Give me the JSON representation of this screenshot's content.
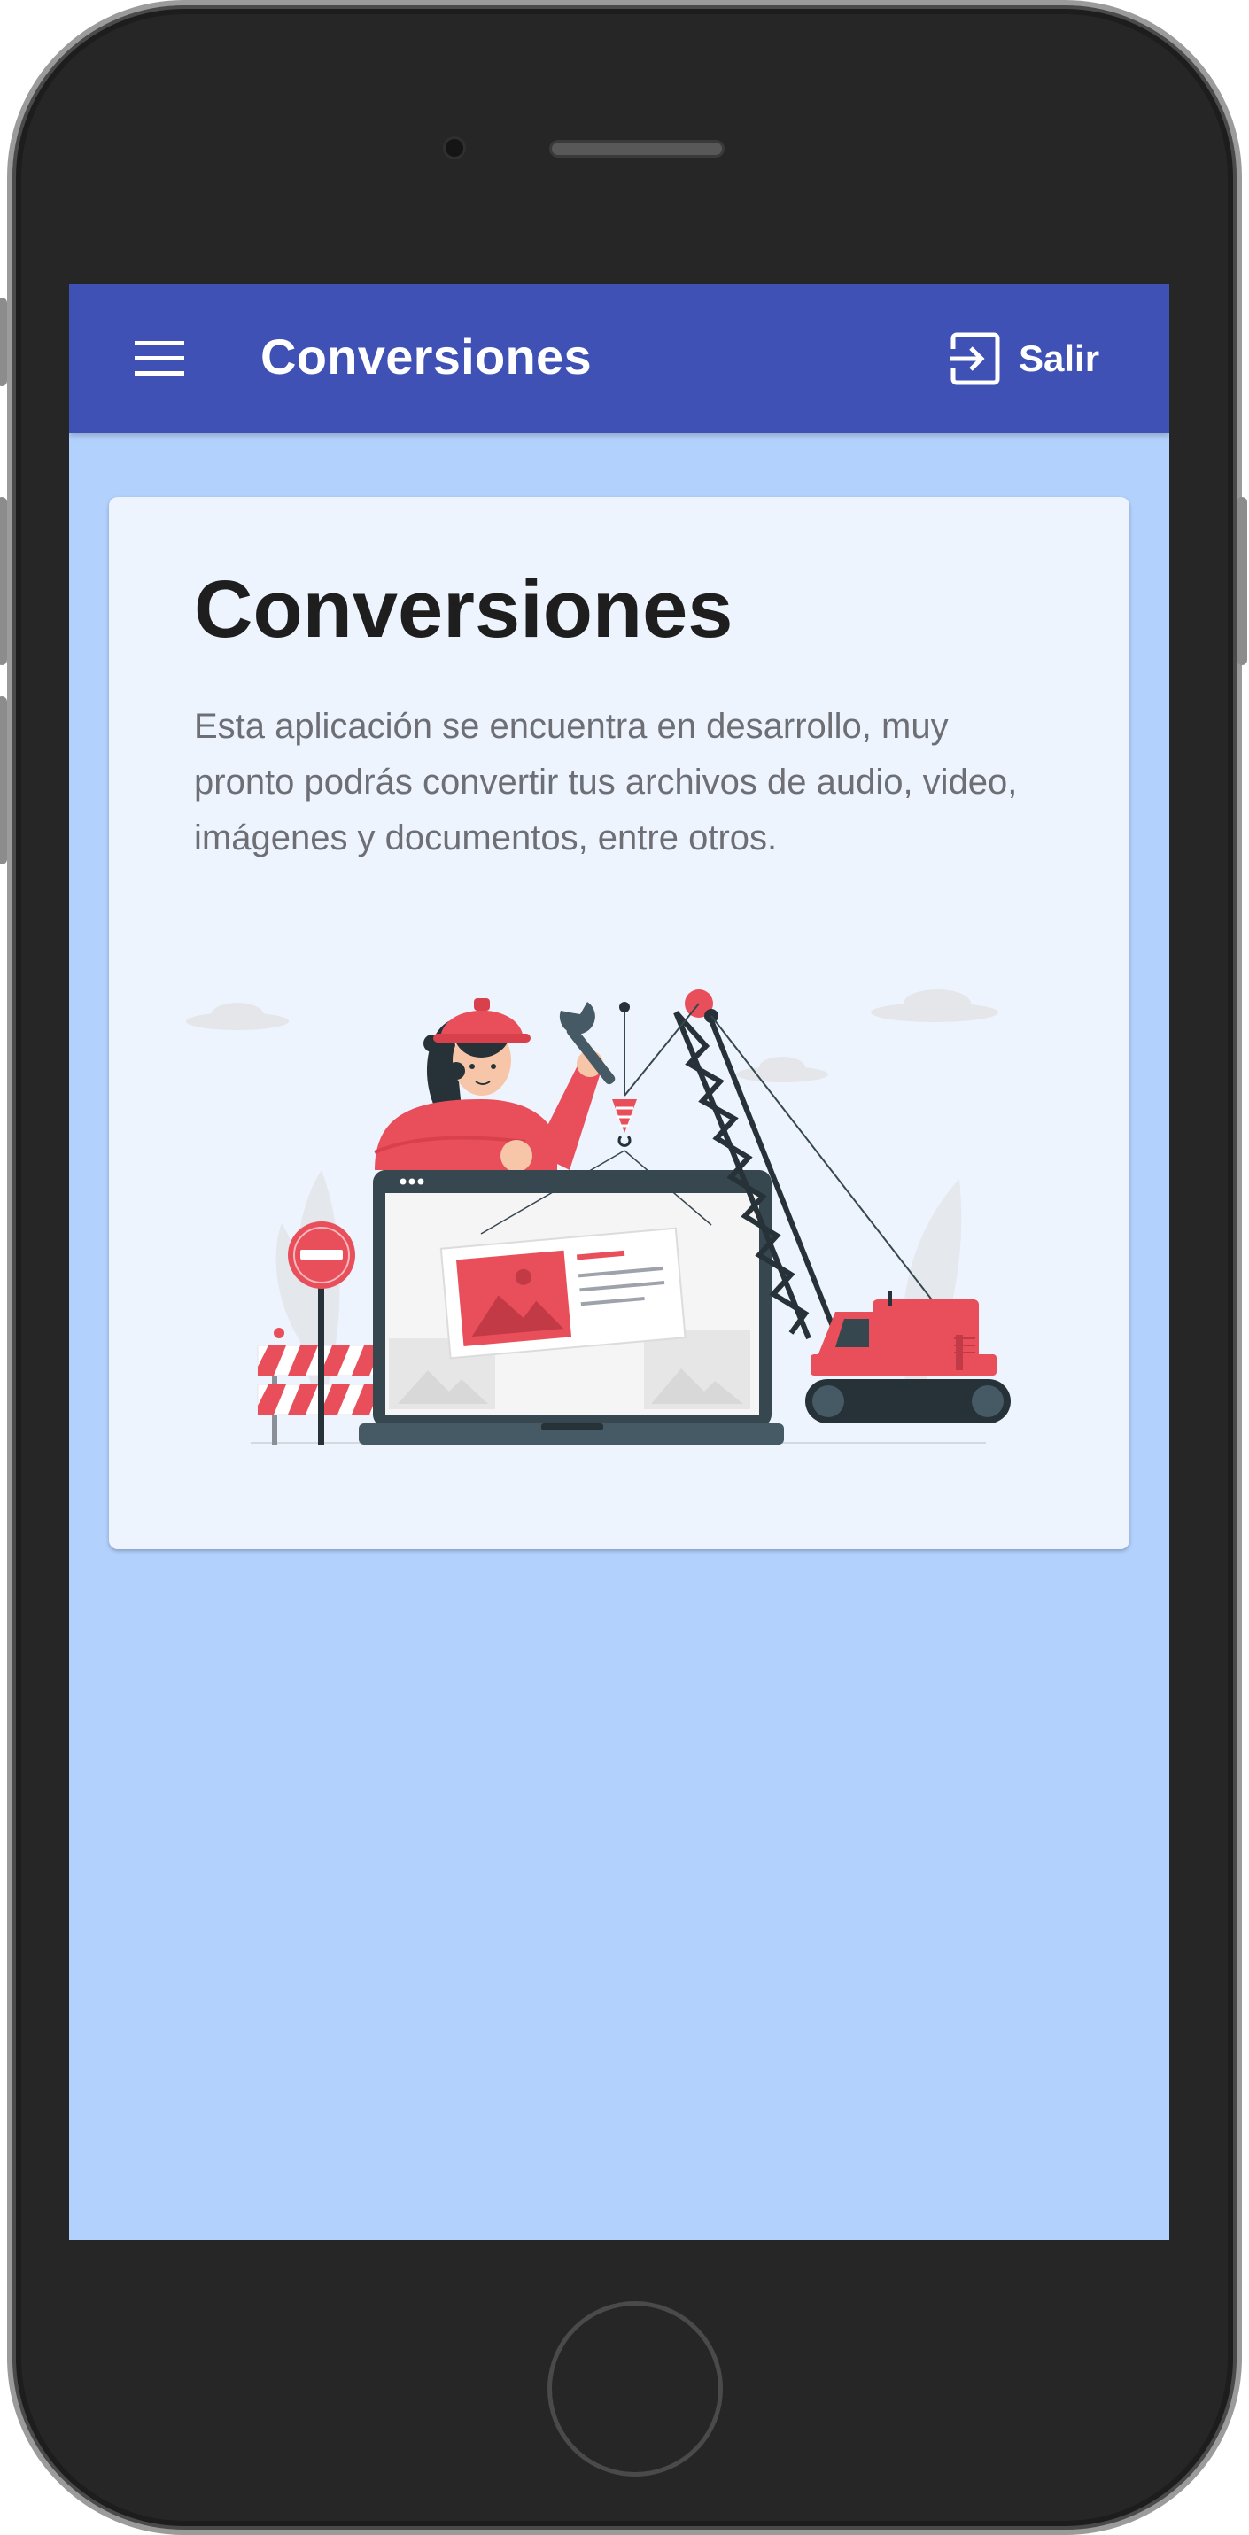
{
  "app_bar": {
    "title": "Conversiones",
    "menu_icon": "menu-icon",
    "logout_icon": "logout-icon",
    "logout_label": "Salir",
    "background_color": "#3f51b5"
  },
  "card": {
    "heading": "Conversiones",
    "description": "Esta aplicación se encuentra en desarrollo, muy pronto podrás convertir tus archivos de audio, video, imágenes y documentos, entre otros.",
    "illustration": "under-construction-illustration"
  },
  "colors": {
    "screen_background": "#b3d1fd",
    "card_background": "#eef4fe",
    "accent_red": "#e84f5b",
    "dark_gray": "#37474f"
  }
}
